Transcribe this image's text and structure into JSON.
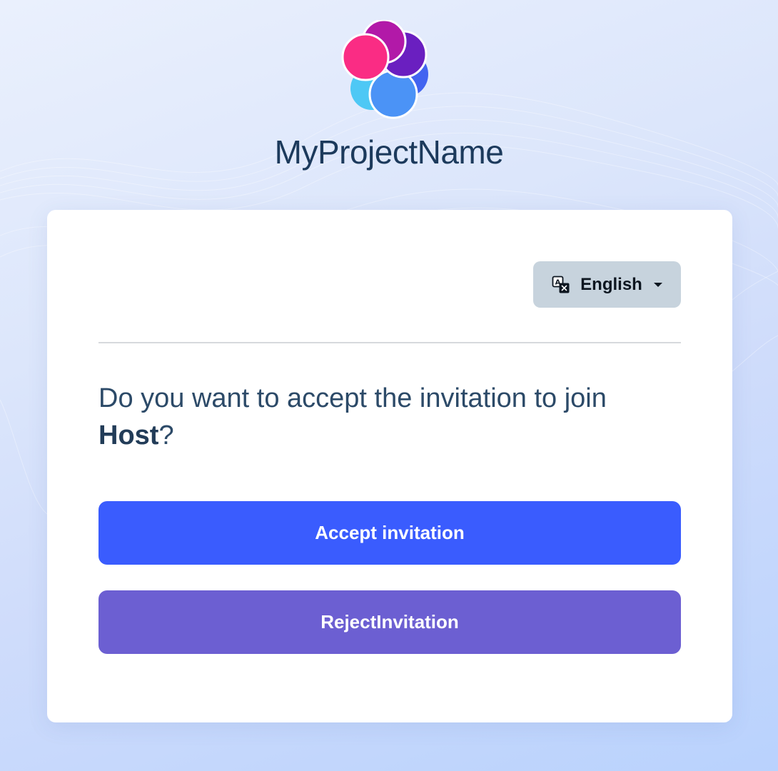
{
  "brand": {
    "name": "MyProjectName",
    "logo_icon": "flower-logo-icon"
  },
  "language": {
    "icon": "translate-icon",
    "selected": "English"
  },
  "invitation": {
    "prompt_prefix": "Do you want to accept the invitation to join ",
    "host_name": "Host",
    "prompt_suffix": "?"
  },
  "actions": {
    "accept_label": "Accept invitation",
    "reject_label": "RejectInvitation"
  },
  "colors": {
    "accept": "#3a5cfe",
    "reject": "#6c5fd2",
    "language_button": "#c7d3dd",
    "brand_text": "#1c3a5c"
  }
}
